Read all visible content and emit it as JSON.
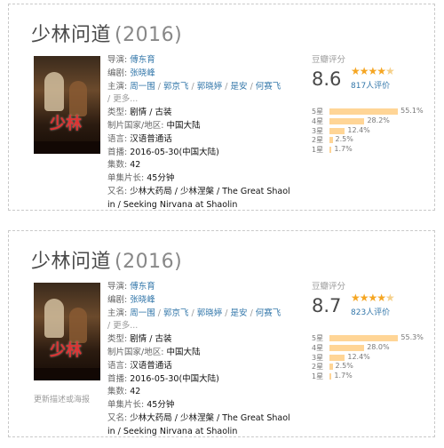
{
  "cards": [
    {
      "title": "少林问道",
      "year": "(2016)",
      "poster_text": "少林",
      "director_label": "导演:",
      "director": "傅东育",
      "writer_label": "编剧:",
      "writer": "张晓峰",
      "cast_label": "主演:",
      "cast": [
        "周一围",
        "郭京飞",
        "郭晓婷",
        "是安",
        "何赛飞"
      ],
      "more": "更多...",
      "genre_label": "类型:",
      "genres": [
        "剧情",
        "古装"
      ],
      "country_label": "制片国家/地区:",
      "country": "中国大陆",
      "language_label": "语言:",
      "language": "汉语普通话",
      "premiere_label": "首播:",
      "premiere": "2016-05-30(中国大陆)",
      "episodes_label": "集数:",
      "episodes": "42",
      "runtime_label": "单集片长:",
      "runtime": "45分钟",
      "aka_label": "又名:",
      "aka_line1": "少林大药局 / 少林涅槃 / The Great Shaol",
      "aka_line2": "in / Seeking Nirvana at Shaolin",
      "rating_head": "豆瓣评分",
      "score": "8.6",
      "votes": "817人评价",
      "dist": [
        {
          "label": "5星",
          "percent": 55.1,
          "text": "55.1%"
        },
        {
          "label": "4星",
          "percent": 28.2,
          "text": "28.2%"
        },
        {
          "label": "3星",
          "percent": 12.4,
          "text": "12.4%"
        },
        {
          "label": "2星",
          "percent": 2.5,
          "text": "2.5%"
        },
        {
          "label": "1星",
          "percent": 1.7,
          "text": "1.7%"
        }
      ],
      "update_text": ""
    },
    {
      "title": "少林问道",
      "year": "(2016)",
      "poster_text": "少林",
      "director_label": "导演:",
      "director": "傅东育",
      "writer_label": "编剧:",
      "writer": "张晓峰",
      "cast_label": "主演:",
      "cast": [
        "周一围",
        "郭京飞",
        "郭晓婷",
        "是安",
        "何赛飞"
      ],
      "more": "更多...",
      "genre_label": "类型:",
      "genres": [
        "剧情",
        "古装"
      ],
      "country_label": "制片国家/地区:",
      "country": "中国大陆",
      "language_label": "语言:",
      "language": "汉语普通话",
      "premiere_label": "首播:",
      "premiere": "2016-05-30(中国大陆)",
      "episodes_label": "集数:",
      "episodes": "42",
      "runtime_label": "单集片长:",
      "runtime": "45分钟",
      "aka_label": "又名:",
      "aka_line1": "少林大药局 / 少林涅槃 / The Great Shaol",
      "aka_line2": "in / Seeking Nirvana at Shaolin",
      "rating_head": "豆瓣评分",
      "score": "8.7",
      "votes": "823人评价",
      "dist": [
        {
          "label": "5星",
          "percent": 55.3,
          "text": "55.3%"
        },
        {
          "label": "4星",
          "percent": 28.0,
          "text": "28.0%"
        },
        {
          "label": "3星",
          "percent": 12.4,
          "text": "12.4%"
        },
        {
          "label": "2星",
          "percent": 2.5,
          "text": "2.5%"
        },
        {
          "label": "1星",
          "percent": 1.7,
          "text": "1.7%"
        }
      ],
      "update_text": "更新描述或海报"
    }
  ],
  "colors": {
    "link": "#3377aa",
    "star": "#f5a623",
    "bar": "#ffd596",
    "border": "#c9c9c9"
  }
}
